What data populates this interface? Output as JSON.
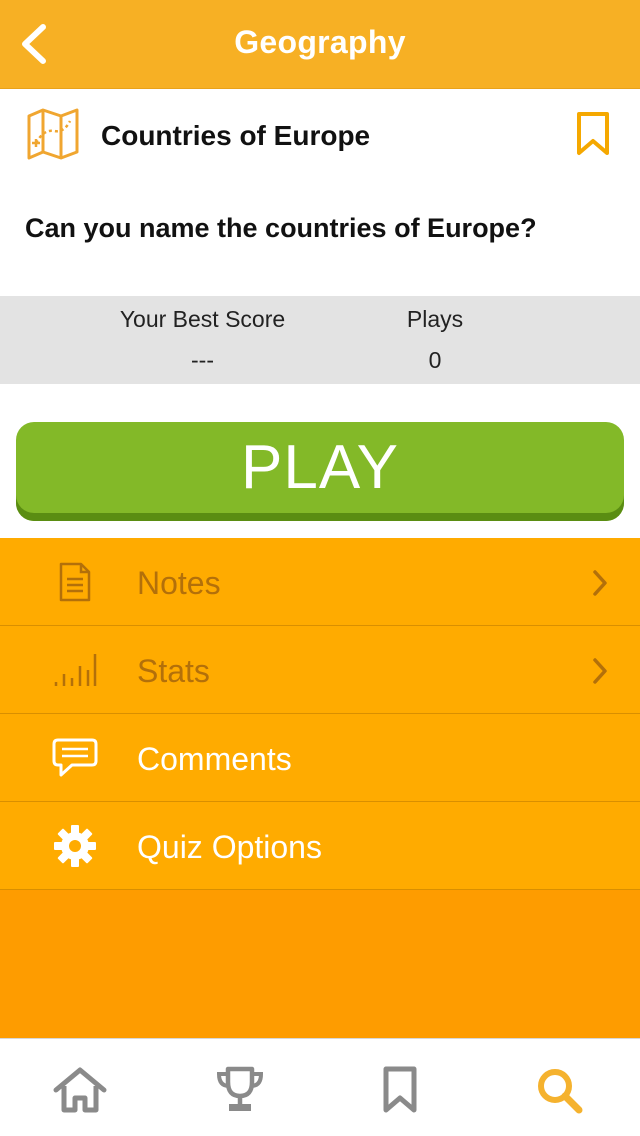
{
  "header": {
    "title": "Geography",
    "back_icon": "chevron-left-icon"
  },
  "quiz": {
    "icon": "map-icon",
    "title": "Countries of Europe",
    "bookmark_icon": "bookmark-icon",
    "description": "Can you name the countries of Europe?"
  },
  "stats": {
    "best_score_label": "Your Best Score",
    "best_score_value": "---",
    "plays_label": "Plays",
    "plays_value": "0"
  },
  "play_button": {
    "label": "PLAY"
  },
  "menu": {
    "items": [
      {
        "label": "Notes",
        "icon": "notes-icon",
        "has_chevron": true,
        "enabled": false
      },
      {
        "label": "Stats",
        "icon": "stats-icon",
        "has_chevron": true,
        "enabled": false
      },
      {
        "label": "Comments",
        "icon": "comment-icon",
        "has_chevron": false,
        "enabled": true
      },
      {
        "label": "Quiz Options",
        "icon": "gear-icon",
        "has_chevron": false,
        "enabled": true
      }
    ]
  },
  "tabbar": {
    "tabs": [
      {
        "icon": "home-icon",
        "active": false
      },
      {
        "icon": "trophy-icon",
        "active": false
      },
      {
        "icon": "bookmark-icon",
        "active": false
      },
      {
        "icon": "search-icon",
        "active": true
      }
    ]
  },
  "colors": {
    "header": "#f7b024",
    "menu": "#ffab00",
    "menu_bg": "#fe9c00",
    "play": "#83b928",
    "active_tab": "#f5b22e",
    "inactive_tab": "#8a8a8a"
  }
}
